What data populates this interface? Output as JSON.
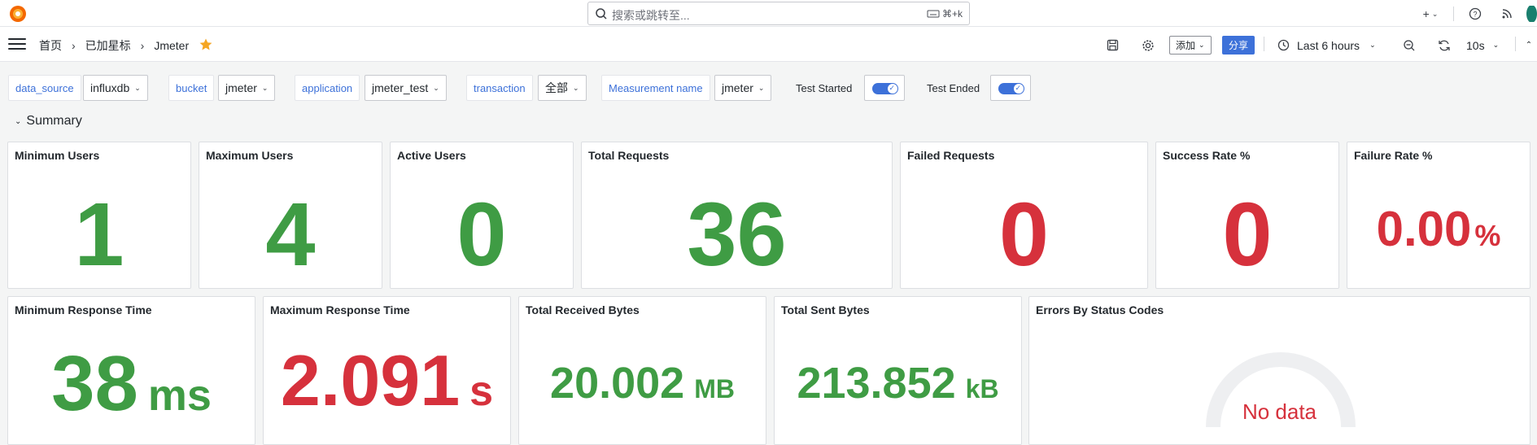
{
  "topbar": {
    "search_placeholder": "搜索或跳转至...",
    "shortcut": "⌘+k",
    "icons": [
      "plus-icon",
      "help-icon",
      "rss-icon",
      "user-avatar"
    ]
  },
  "nav": {
    "breadcrumb": [
      "首页",
      "已加星标",
      "Jmeter"
    ],
    "add_label": "添加",
    "share_label": "分享",
    "time_range": "Last 6 hours",
    "refresh_interval": "10s"
  },
  "variables": [
    {
      "label": "data_source",
      "value": "influxdb"
    },
    {
      "label": "bucket",
      "value": "jmeter"
    },
    {
      "label": "application",
      "value": "jmeter_test"
    },
    {
      "label": "transaction",
      "value": "全部"
    },
    {
      "label": "Measurement name",
      "value": "jmeter"
    }
  ],
  "toggles": [
    {
      "label": "Test Started",
      "on": true
    },
    {
      "label": "Test Ended",
      "on": true
    }
  ],
  "row_title": "Summary",
  "stats_row1": [
    {
      "title": "Minimum Users",
      "value": "1",
      "unit": "",
      "color": "#3f9c44"
    },
    {
      "title": "Maximum Users",
      "value": "4",
      "unit": "",
      "color": "#3f9c44"
    },
    {
      "title": "Active Users",
      "value": "0",
      "unit": "",
      "color": "#3f9c44"
    },
    {
      "title": "Total Requests",
      "value": "36",
      "unit": "",
      "color": "#3f9c44"
    },
    {
      "title": "Failed Requests",
      "value": "0",
      "unit": "",
      "color": "#d6313c"
    },
    {
      "title": "Success Rate %",
      "value": "0",
      "unit": "",
      "color": "#d6313c"
    },
    {
      "title": "Failure Rate %",
      "value": "0.00",
      "unit": "%",
      "color": "#d6313c"
    }
  ],
  "stats_row2": [
    {
      "title": "Minimum Response Time",
      "value": "38",
      "unit": "ms",
      "color": "#3f9c44"
    },
    {
      "title": "Maximum Response Time",
      "value": "2.091",
      "unit": "s",
      "color": "#d6313c"
    },
    {
      "title": "Total Received Bytes",
      "value": "20.002",
      "unit": "MB",
      "color": "#3f9c44"
    },
    {
      "title": "Total Sent Bytes",
      "value": "213.852",
      "unit": "kB",
      "color": "#3f9c44"
    }
  ],
  "errors_panel": {
    "title": "Errors By Status Codes",
    "no_data": "No data"
  },
  "colors": {
    "accent": "#3d71d9",
    "green": "#3f9c44",
    "red": "#d6313c"
  }
}
